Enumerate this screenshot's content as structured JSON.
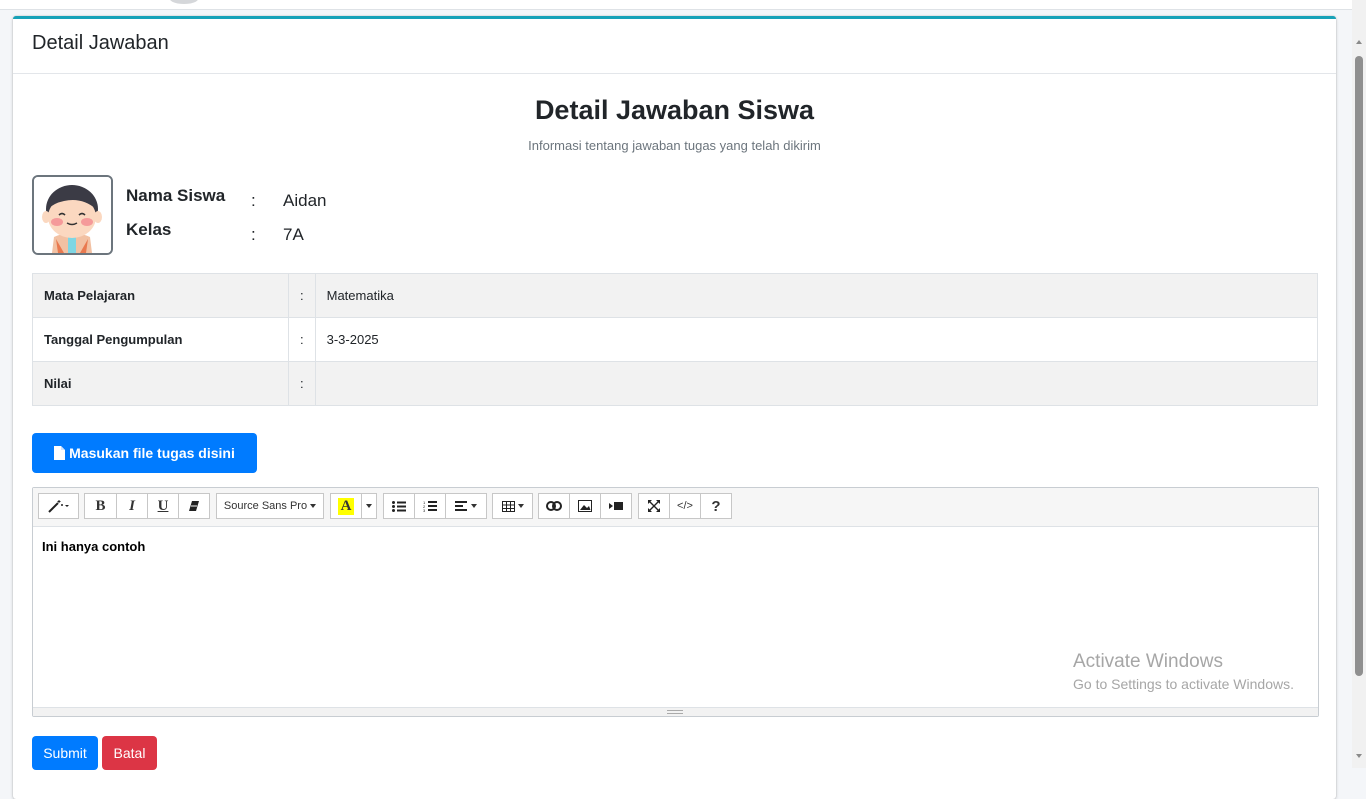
{
  "card": {
    "title": "Detail Jawaban"
  },
  "heading": {
    "title": "Detail Jawaban Siswa",
    "subtitle": "Informasi tentang jawaban tugas yang telah dikirim"
  },
  "student": {
    "name_label": "Nama Siswa",
    "name_value": "Aidan",
    "class_label": "Kelas",
    "class_value": "7A",
    "separator": ":"
  },
  "details": {
    "separator": ":",
    "rows": [
      {
        "label": "Mata Pelajaran",
        "value": "Matematika"
      },
      {
        "label": "Tanggal Pengumpulan",
        "value": "3-3-2025"
      },
      {
        "label": "Nilai",
        "value": ""
      }
    ]
  },
  "upload_button": {
    "label": "Masukan file tugas disini",
    "icon": "file-icon"
  },
  "editor": {
    "font_dropdown": "Source Sans Pro",
    "bold_label": "B",
    "italic_label": "I",
    "underline_label": "U",
    "color_label": "A",
    "help_label": "?",
    "code_label": "</>",
    "content": "Ini hanya contoh",
    "highlight_color": "#ffff00"
  },
  "watermark": {
    "line1": "Activate Windows",
    "line2": "Go to Settings to activate Windows."
  },
  "actions": {
    "submit_label": "Submit",
    "cancel_label": "Batal"
  },
  "colors": {
    "primary": "#007bff",
    "danger": "#dc3545",
    "card_accent": "#17a2b8"
  }
}
